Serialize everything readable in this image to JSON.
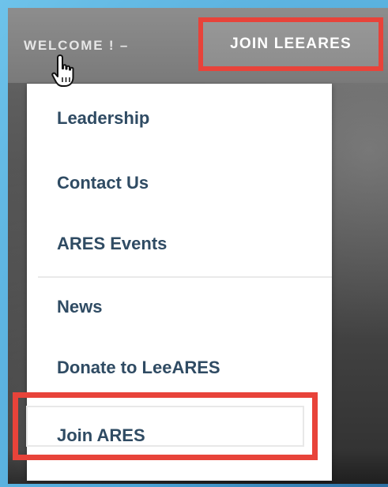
{
  "nav": {
    "welcome_label": "WELCOME ! –",
    "join_label": "JOIN LEEARES"
  },
  "dropdown": {
    "items": [
      {
        "label": "Leadership"
      },
      {
        "label": "Contact Us"
      },
      {
        "label": "ARES Events"
      },
      {
        "label": "News"
      },
      {
        "label": "Donate to LeeARES"
      },
      {
        "label": "Join ARES"
      }
    ]
  },
  "icons": {
    "cursor": "hand-pointer-icon"
  },
  "colors": {
    "highlight_border": "#e8433a",
    "menu_text": "#2f4b63",
    "menu_bg": "#ffffff",
    "nav_text": "#e6e6e6"
  }
}
